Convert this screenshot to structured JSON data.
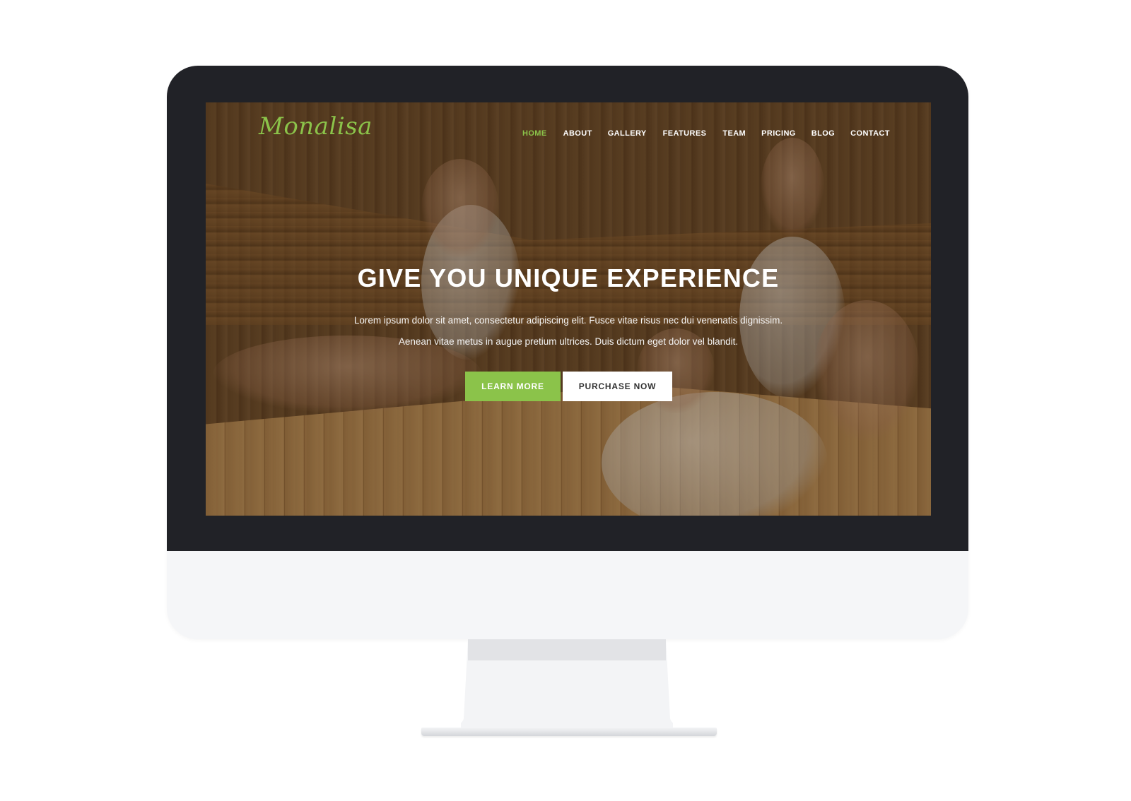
{
  "brand": {
    "logo_text": "Monalisa",
    "accent_color": "#8bc34a"
  },
  "nav": {
    "items": [
      {
        "label": "HOME",
        "active": true
      },
      {
        "label": "ABOUT",
        "active": false
      },
      {
        "label": "GALLERY",
        "active": false
      },
      {
        "label": "FEATURES",
        "active": false
      },
      {
        "label": "TEAM",
        "active": false
      },
      {
        "label": "PRICING",
        "active": false
      },
      {
        "label": "BLOG",
        "active": false
      },
      {
        "label": "CONTACT",
        "active": false
      }
    ]
  },
  "hero": {
    "title": "GIVE YOU UNIQUE EXPERIENCE",
    "line1": "Lorem ipsum dolor sit amet, consectetur adipiscing elit. Fusce vitae risus nec dui venenatis dignissim.",
    "line2": "Aenean vitae metus in augue pretium ultrices. Duis dictum eget dolor vel blandit.",
    "learn_more_label": "LEARN MORE",
    "purchase_label": "PURCHASE NOW"
  },
  "device": {
    "type": "desktop-monitor-mockup",
    "bezel_color": "#212227",
    "chin_color": "#f5f6f8"
  }
}
